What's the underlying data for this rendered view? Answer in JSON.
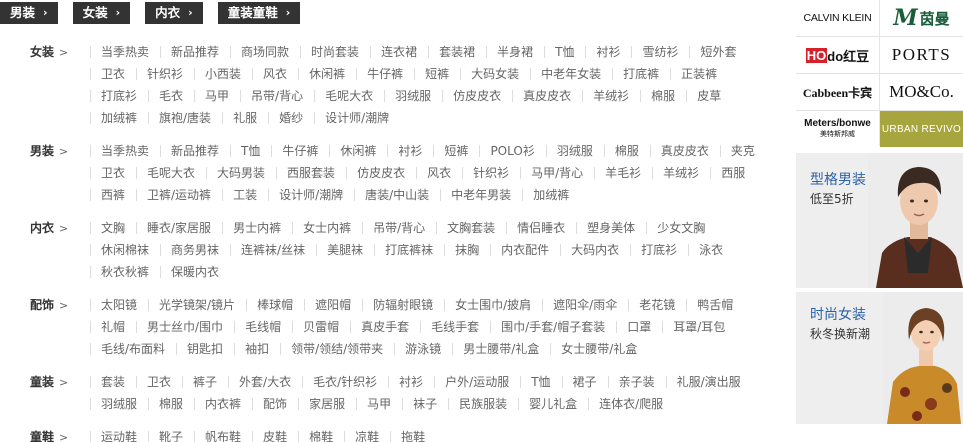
{
  "tabs": [
    {
      "label": "男装"
    },
    {
      "label": "女装"
    },
    {
      "label": "内衣"
    },
    {
      "label": "童装童鞋"
    }
  ],
  "categories": [
    {
      "title": "女装",
      "links": [
        "当季热卖",
        "新品推荐",
        "商场同款",
        "时尚套装",
        "连衣裙",
        "套装裙",
        "半身裙",
        "T恤",
        "衬衫",
        "雪纺衫",
        "短外套",
        "卫衣",
        "针织衫",
        "小西装",
        "风衣",
        "休闲裤",
        "牛仔裤",
        "短裤",
        "大码女装",
        "中老年女装",
        "打底裤",
        "正装裤",
        "打底衫",
        "毛衣",
        "马甲",
        "吊带/背心",
        "毛呢大衣",
        "羽绒服",
        "仿皮皮衣",
        "真皮皮衣",
        "羊绒衫",
        "棉服",
        "皮草",
        "加绒裤",
        "旗袍/唐装",
        "礼服",
        "婚纱",
        "设计师/潮牌"
      ]
    },
    {
      "title": "男装",
      "links": [
        "当季热卖",
        "新品推荐",
        "T恤",
        "牛仔裤",
        "休闲裤",
        "衬衫",
        "短裤",
        "POLO衫",
        "羽绒服",
        "棉服",
        "真皮皮衣",
        "夹克",
        "卫衣",
        "毛呢大衣",
        "大码男装",
        "西服套装",
        "仿皮皮衣",
        "风衣",
        "针织衫",
        "马甲/背心",
        "羊毛衫",
        "羊绒衫",
        "西服",
        "西裤",
        "卫裤/运动裤",
        "工装",
        "设计师/潮牌",
        "唐装/中山装",
        "中老年男装",
        "加绒裤"
      ]
    },
    {
      "title": "内衣",
      "links": [
        "文胸",
        "睡衣/家居服",
        "男士内裤",
        "女士内裤",
        "吊带/背心",
        "文胸套装",
        "情侣睡衣",
        "塑身美体",
        "少女文胸",
        "休闲棉袜",
        "商务男袜",
        "连裤袜/丝袜",
        "美腿袜",
        "打底裤袜",
        "抹胸",
        "内衣配件",
        "大码内衣",
        "打底衫",
        "泳衣",
        "秋衣秋裤",
        "保暖内衣"
      ]
    },
    {
      "title": "配饰",
      "links": [
        "太阳镜",
        "光学镜架/镜片",
        "棒球帽",
        "遮阳帽",
        "防辐射眼镜",
        "女士围巾/披肩",
        "遮阳伞/雨伞",
        "老花镜",
        "鸭舌帽",
        "礼帽",
        "男士丝巾/围巾",
        "毛线帽",
        "贝雷帽",
        "真皮手套",
        "毛线手套",
        "围巾/手套/帽子套装",
        "口罩",
        "耳罩/耳包",
        "毛线/布面料",
        "钥匙扣",
        "袖扣",
        "领带/领结/领带夹",
        "游泳镜",
        "男士腰带/礼盒",
        "女士腰带/礼盒"
      ]
    },
    {
      "title": "童装",
      "links": [
        "套装",
        "卫衣",
        "裤子",
        "外套/大衣",
        "毛衣/针织衫",
        "衬衫",
        "户外/运动服",
        "T恤",
        "裙子",
        "亲子装",
        "礼服/演出服",
        "羽绒服",
        "棉服",
        "内衣裤",
        "配饰",
        "家居服",
        "马甲",
        "袜子",
        "民族服装",
        "婴儿礼盒",
        "连体衣/爬服"
      ]
    },
    {
      "title": "童鞋",
      "links": [
        "运动鞋",
        "靴子",
        "帆布鞋",
        "皮鞋",
        "棉鞋",
        "凉鞋",
        "拖鞋"
      ]
    }
  ],
  "brands": {
    "calvin": "CALVIN KLEIN",
    "yinman_m": "M",
    "yinman_cn": "茵曼",
    "hodo_ho": "HO",
    "hodo_rest": "do红豆",
    "ports": "PORTS",
    "cabbeen": "Cabbeen卡宾",
    "moco": "MO&Co.",
    "meters_en": "Meters/bonwe",
    "meters_cn": "美特斯邦威",
    "urban": "URBAN REVIVO"
  },
  "promos": [
    {
      "title": "型格男装",
      "subtitle": "低至5折"
    },
    {
      "title": "时尚女装",
      "subtitle": "秋冬换新潮"
    }
  ],
  "colors": {
    "tab_bg": "#333333",
    "promo_title": "#2c62a7",
    "urban_bg": "#a6a53e",
    "hodo_red": "#d6202a",
    "yinman_green": "#1a5d3a"
  },
  "icons": {
    "tab_chevron": "›",
    "cat_chevron": ">"
  }
}
